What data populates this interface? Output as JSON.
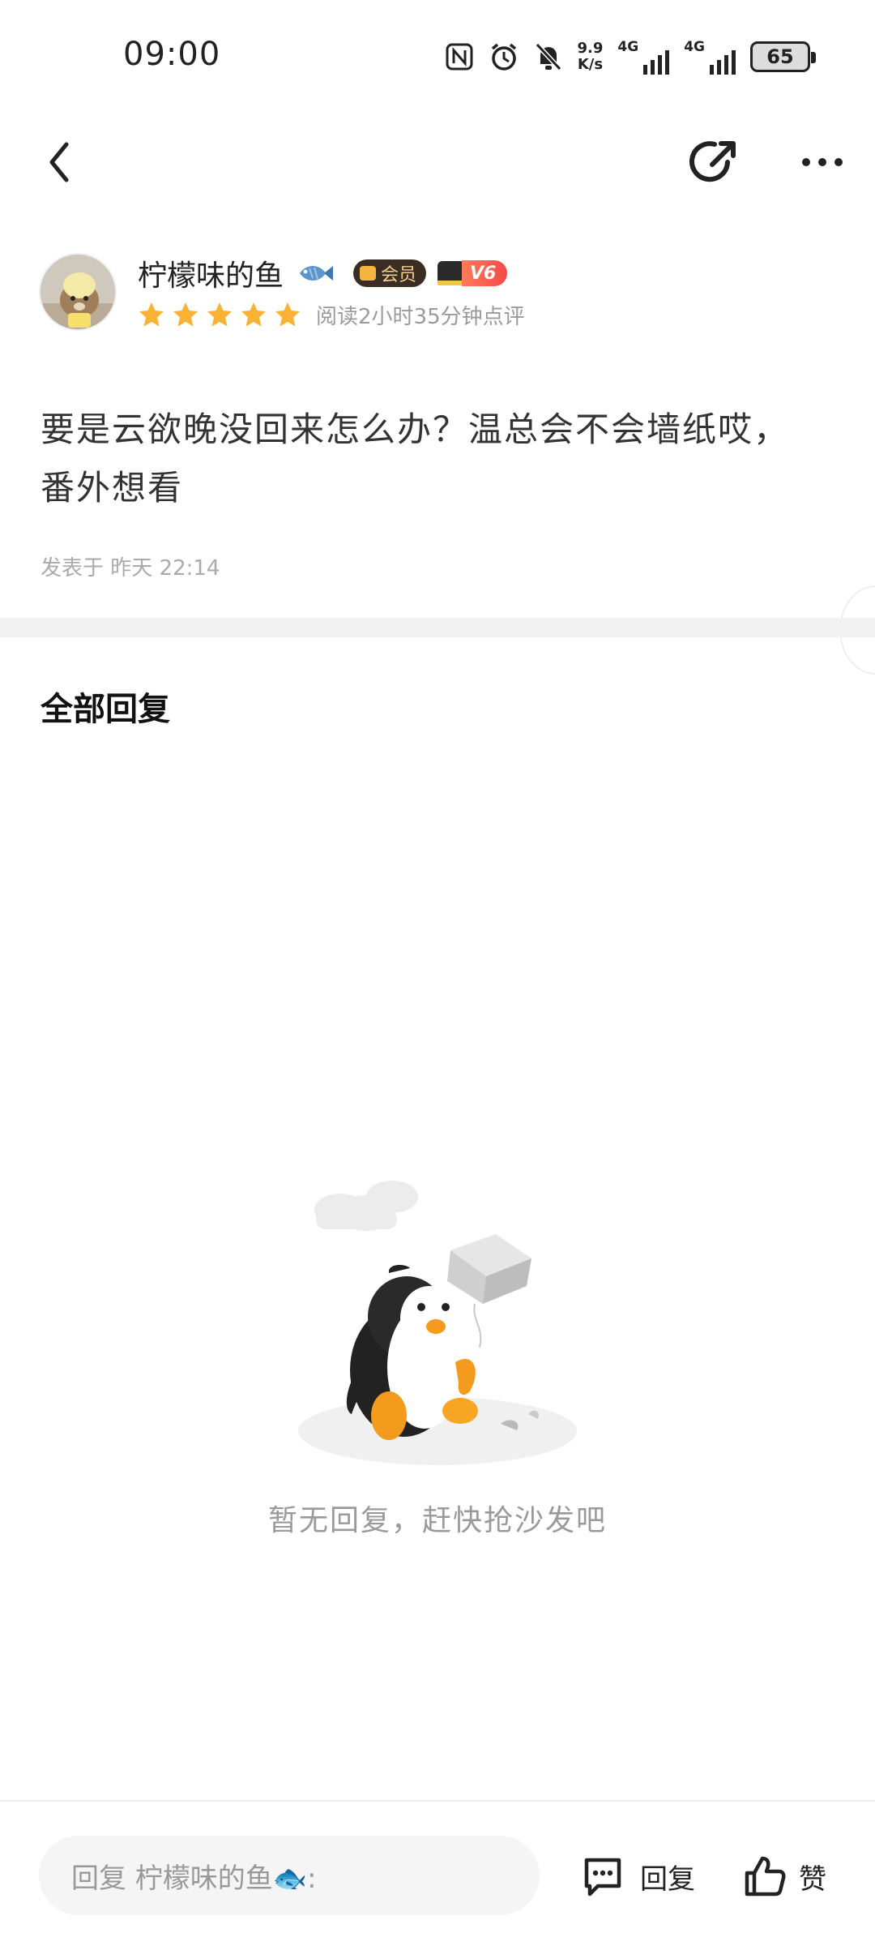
{
  "status_bar": {
    "time": "09:00",
    "net_speed_top": "9.9",
    "net_speed_bottom": "K/s",
    "sim1_label": "4G",
    "sim2_label": "4G",
    "battery": "65"
  },
  "author": {
    "name": "柠檬味的鱼",
    "vip_label": "会员",
    "level_label": "V6",
    "rating_stars": 5,
    "reading_info": "阅读2小时35分钟点评"
  },
  "post": {
    "content": "要是云欲晚没回来怎么办？温总会不会墙纸哎，番外想看",
    "time": "发表于 昨天 22:14"
  },
  "replies": {
    "title": "全部回复",
    "empty_text": "暂无回复，赶快抢沙发吧"
  },
  "bottom_bar": {
    "input_placeholder": "回复 柠檬味的鱼🐟:",
    "reply_label": "回复",
    "like_label": "赞"
  },
  "colors": {
    "star": "#f9b233",
    "vip_bg": "#3a2e24",
    "level_bg": "#f64a4a",
    "divider": "#f2f2f2"
  }
}
